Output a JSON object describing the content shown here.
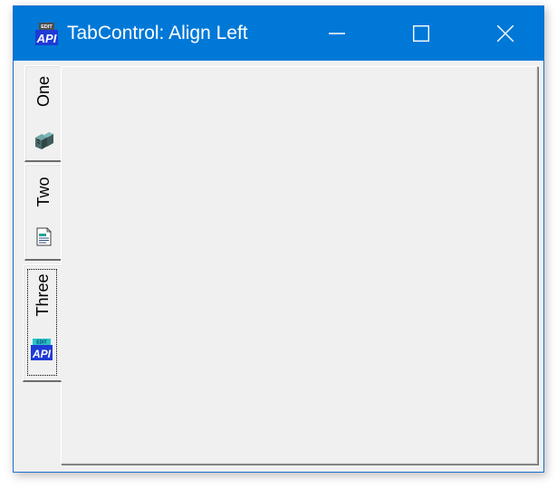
{
  "window": {
    "title": "TabControl: Align Left",
    "app_icon": "api-app-icon",
    "controls": {
      "minimize": "minimize-icon",
      "maximize": "maximize-icon",
      "close": "close-icon"
    }
  },
  "tabs": [
    {
      "label": "One",
      "icon": "books-icon",
      "selected": false
    },
    {
      "label": "Two",
      "icon": "document-icon",
      "selected": false
    },
    {
      "label": "Three",
      "icon": "api-icon",
      "selected": true,
      "focused": true
    }
  ],
  "colors": {
    "titlebar": "#0078d7",
    "window_bg": "#f0f0f0",
    "title_text": "#ffffff"
  }
}
